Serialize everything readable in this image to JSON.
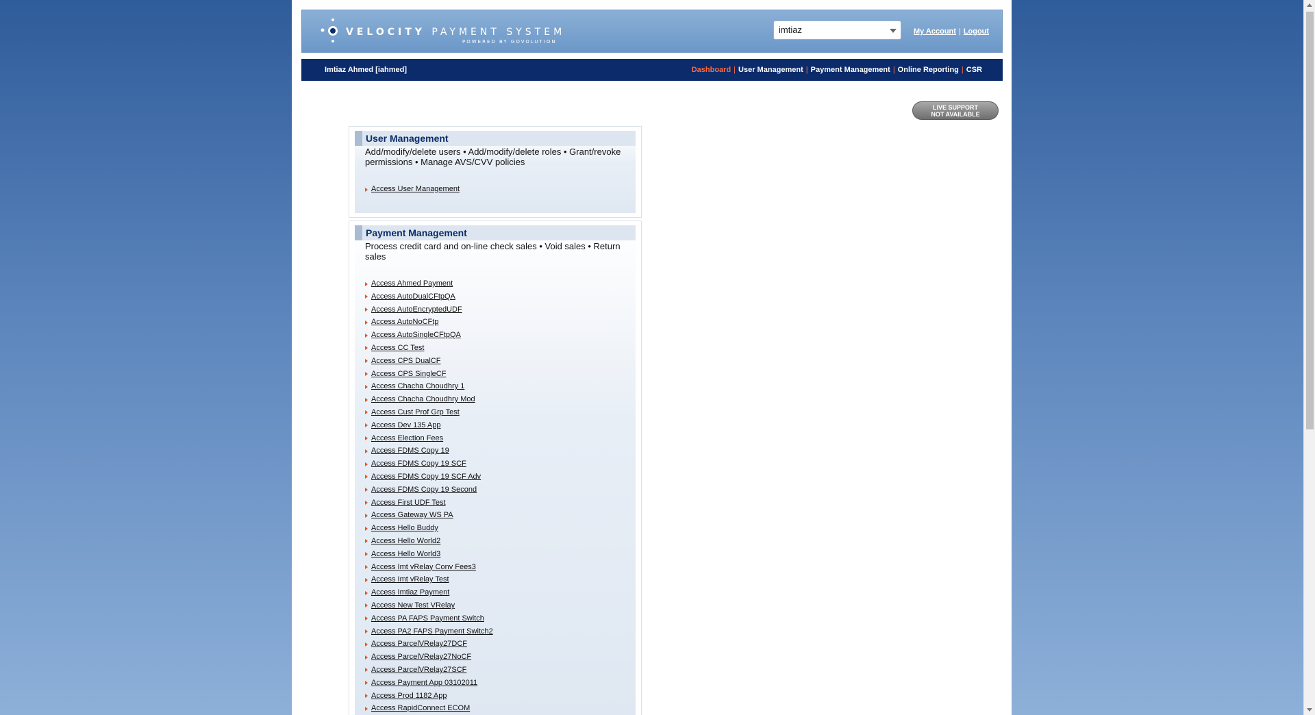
{
  "header": {
    "brand_word1": "VELOCITY",
    "brand_word2": "PAYMENT SYSTEM",
    "powered_by": "POWERED BY GOVOLUTION",
    "account_select_value": "imtiaz",
    "my_account": "My Account",
    "logout": "Logout"
  },
  "navbar": {
    "user": "Imtiaz Ahmed [iahmed]",
    "links": [
      "Dashboard",
      "User Management",
      "Payment Management",
      "Online Reporting",
      "CSR"
    ],
    "active": "Dashboard"
  },
  "live_support": {
    "line1": "LIVE SUPPORT",
    "line2": "NOT AVAILABLE"
  },
  "user_management": {
    "title": "User Management",
    "description": "Add/modify/delete users • Add/modify/delete roles • Grant/revoke permissions • Manage AVS/CVV policies",
    "links": [
      "Access User Management"
    ]
  },
  "payment_management": {
    "title": "Payment Management",
    "description": "Process credit card and on-line check sales • Void sales • Return sales",
    "links": [
      "Access Ahmed Payment",
      "Access AutoDualCFtpQA",
      "Access AutoEncryptedUDF",
      "Access AutoNoCFtp",
      "Access AutoSingleCFtpQA",
      "Access CC Test",
      "Access CPS DualCF",
      "Access CPS SingleCF",
      "Access Chacha Choudhry 1",
      "Access Chacha Choudhry Mod",
      "Access Cust Prof Grp Test",
      "Access Dev 135 App",
      "Access Election Fees",
      "Access FDMS Copy 19",
      "Access FDMS Copy 19 SCF",
      "Access FDMS Copy 19 SCF Adv",
      "Access FDMS Copy 19 Second",
      "Access First UDF Test",
      "Access Gateway WS PA",
      "Access Hello Buddy",
      "Access Hello World2",
      "Access Hello World3",
      "Access Imt vRelay Conv Fees3",
      "Access Imt vRelay Test",
      "Access Imtiaz Payment",
      "Access New Test VRelay",
      "Access PA FAPS Payment Switch",
      "Access PA2 FAPS Payment Switch2",
      "Access ParcelVRelay27DCF",
      "Access ParcelVRelay27NoCF",
      "Access ParcelVRelay27SCF",
      "Access Payment App 03102011",
      "Access Prod 1182 App",
      "Access RapidConnect ECOM"
    ]
  },
  "colors": {
    "navbar_bg": "#0b2b6b",
    "active_nav": "#ff6a3d",
    "panel_title": "#0b2b6b",
    "bullet_arrow": "#e2571f"
  }
}
